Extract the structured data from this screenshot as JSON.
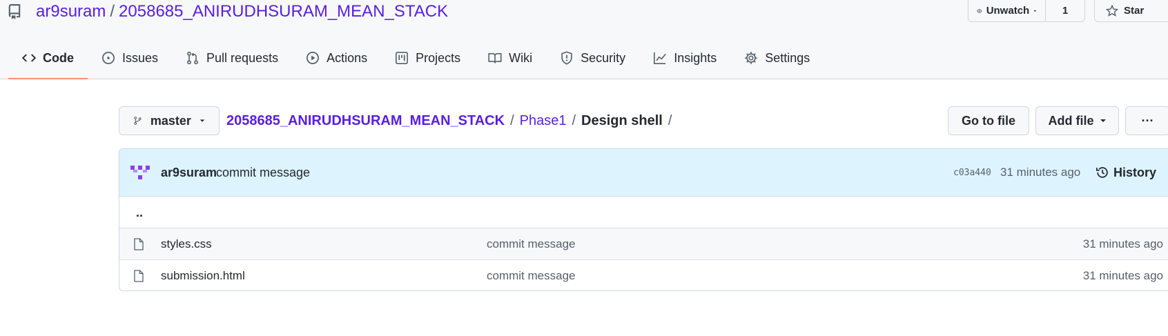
{
  "repo": {
    "owner": "ar9suram",
    "separator": "/",
    "name": "2058685_ANIRUDHSURAM_MEAN_STACK"
  },
  "header_actions": {
    "watch_label": "Unwatch",
    "watch_count": "1",
    "star_label": "Star"
  },
  "tabs": [
    {
      "label": "Code",
      "icon": "code-icon",
      "active": true
    },
    {
      "label": "Issues",
      "icon": "issue-opened-icon"
    },
    {
      "label": "Pull requests",
      "icon": "git-pull-request-icon"
    },
    {
      "label": "Actions",
      "icon": "play-icon"
    },
    {
      "label": "Projects",
      "icon": "project-icon"
    },
    {
      "label": "Wiki",
      "icon": "book-icon"
    },
    {
      "label": "Security",
      "icon": "shield-icon"
    },
    {
      "label": "Insights",
      "icon": "graph-icon"
    },
    {
      "label": "Settings",
      "icon": "gear-icon"
    }
  ],
  "branch": "master",
  "breadcrumb": {
    "root": "2058685_ANIRUDHSURAM_MEAN_STACK",
    "folder": "Phase1",
    "current": "Design shell",
    "sep": "/"
  },
  "file_actions": {
    "go_to_file": "Go to file",
    "add_file": "Add file",
    "more": "···"
  },
  "latest_commit": {
    "author": "ar9suram",
    "message": "commit message",
    "sha": "c03a440",
    "time": "31 minutes ago",
    "history_label": "History"
  },
  "parent_dir": "..",
  "files": [
    {
      "name": "styles.css",
      "message": "commit message",
      "time": "31 minutes ago"
    },
    {
      "name": "submission.html",
      "message": "commit message",
      "time": "31 minutes ago"
    }
  ],
  "colors": {
    "link": "#5a1ee0",
    "commit_bar": "#ddf4ff",
    "tab_underline": "#fd8c73"
  }
}
